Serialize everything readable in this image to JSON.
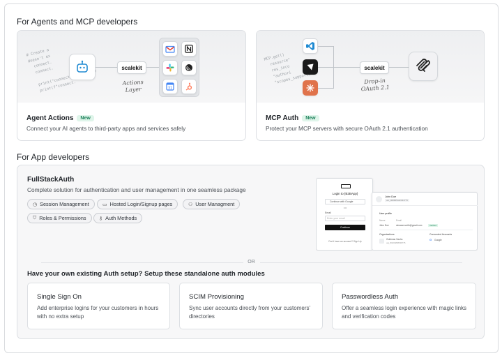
{
  "sections": {
    "agents_title": "For Agents and MCP developers",
    "app_title": "For App developers"
  },
  "agent_card": {
    "title": "Agent Actions",
    "badge": "New",
    "description": "Connect your AI agents to third-party apps and services safely",
    "scalekit_label": "scalekit",
    "handwritten": "Actions\nLayer",
    "code": "# Create a\ndoesn't ex\n  connect.\n  connect.\n\n  print(\"connected account\")\n  print(f\"connect."
  },
  "mcp_card": {
    "title": "MCP Auth",
    "badge": "New",
    "description": "Protect your MCP servers with secure OAuth 2.1 authentication",
    "scalekit_label": "scalekit",
    "handwritten": "Drop-in\nOAuth 2.1",
    "code": "MCP.get()\n  resource\"\n  res_inco\n  \"authori\n  \"scopes_supported\""
  },
  "fullstack": {
    "title": "FullStackAuth",
    "description": "Complete solution for authentication and user management in one seamless package",
    "chips": [
      {
        "label": "Session Management",
        "icon": "clock-icon"
      },
      {
        "label": "Hosted Login/Signup pages",
        "icon": "window-icon"
      },
      {
        "label": "User Managment",
        "icon": "users-icon"
      },
      {
        "label": "Roles & Permissions",
        "icon": "shield-icon"
      },
      {
        "label": "Auth Methods",
        "icon": "key-icon"
      }
    ],
    "or_text": "OR",
    "question": "Have your own existing Auth setup? Setup these standalone auth modules",
    "modules": [
      {
        "title": "Single Sign On",
        "description": "Add enterprise logins for your customers in hours with no extra setup"
      },
      {
        "title": "SCIM Provisioning",
        "description": "Sync user accounts directly from your customers' directories"
      },
      {
        "title": "Passwordless Auth",
        "description": "Offer a seamless login experience with magic links and verification codes"
      }
    ],
    "mock": {
      "login_title": "Login to {B2BApp}",
      "google_button": "Continue with Google",
      "or": "OR",
      "email_label": "Email",
      "email_placeholder": "Enter your email",
      "continue": "Continue",
      "signup": "Don't have an account? Sign Up",
      "user_name": "John Doe",
      "user_id": "usr_908865442334775",
      "user_profile": "User profile",
      "name_col": "Name",
      "email_col": "Email",
      "row_name": "John Doe",
      "row_email": "dewane.smith@gmail.com",
      "verified": "Verified",
      "organizations": "Organizations",
      "connected_accounts": "Connected Accounts",
      "org_name": "Goldman Sachs",
      "org_sub": "org_89466858548775",
      "google": "Google"
    }
  },
  "colors": {
    "badge_bg": "#dff5ea",
    "badge_text": "#1a7f58",
    "gmail_red": "#ea4335",
    "hubspot_orange": "#ff7a59",
    "vscode_blue": "#1f8ad2",
    "claude_orange": "#e0734b"
  }
}
